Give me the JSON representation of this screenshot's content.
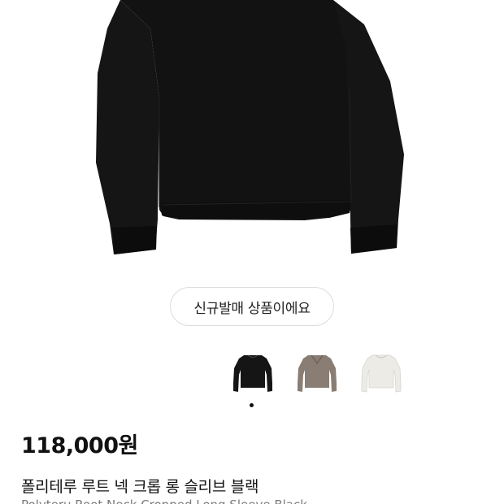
{
  "product": {
    "badge": "신규발매 상품이에요",
    "price": "118,000원",
    "name_ko": "폴리테루 루트 넥 크롭 롱 슬리브 블랙",
    "name_en": "Polyteru Root Neck Cropped Long Sleeve Black"
  },
  "colors": {
    "options": [
      "black",
      "taupe",
      "ivory"
    ],
    "hex": [
      "#151515",
      "#8a7d73",
      "#ecebe6"
    ],
    "selected_index": 0
  },
  "icons": {
    "hero": "sweater-black-image",
    "thumb_1": "sweater-black-thumbnail",
    "thumb_2": "sweater-taupe-thumbnail",
    "thumb_3": "sweater-ivory-thumbnail"
  }
}
